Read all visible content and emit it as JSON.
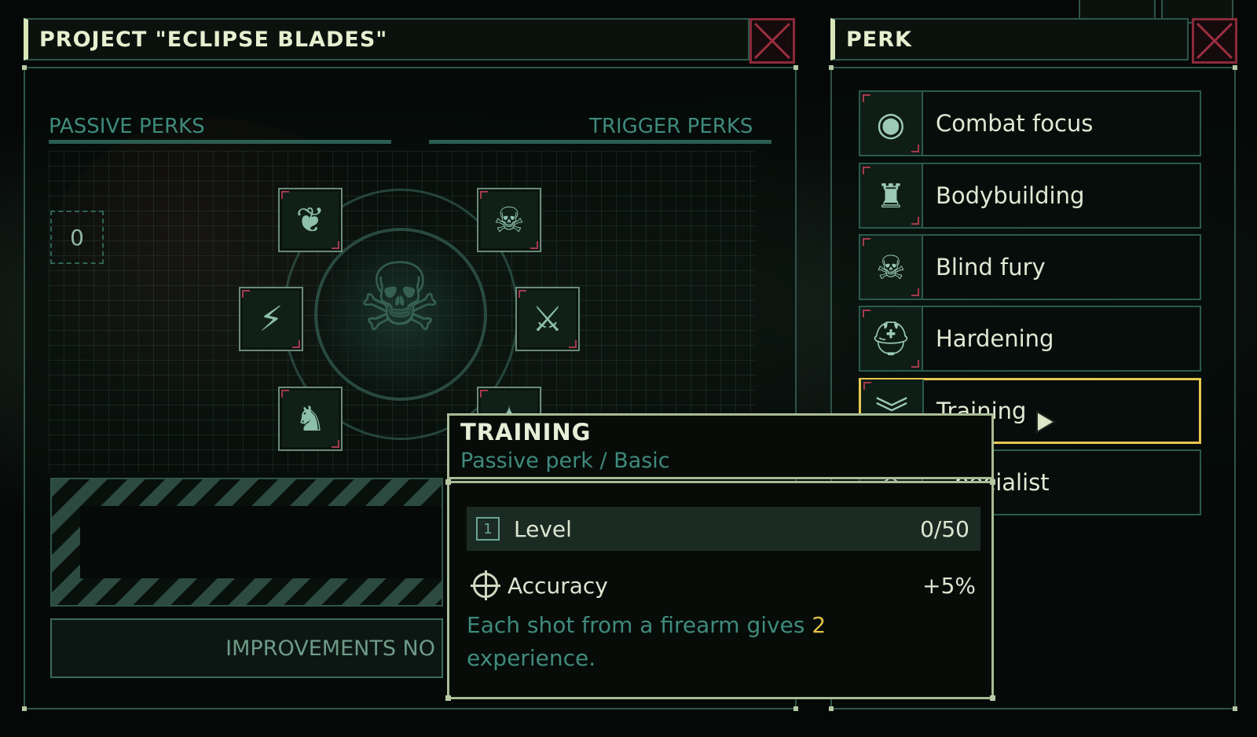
{
  "project_panel": {
    "title": "PROJECT \"ECLIPSE BLADES\"",
    "passive_header": "PASSIVE PERKS",
    "trigger_header": "TRIGGER PERKS",
    "points_counter": "0",
    "improvements_button": "IMPROVEMENTS NO"
  },
  "perk_panel": {
    "title": "PERK",
    "items": [
      {
        "label": "Combat focus",
        "icon": "eye-icon"
      },
      {
        "label": "Bodybuilding",
        "icon": "muscle-icon"
      },
      {
        "label": "Blind fury",
        "icon": "skull-icon"
      },
      {
        "label": "Hardening",
        "icon": "helmet-icon"
      },
      {
        "label": "Training",
        "icon": "chevron-rank-icon",
        "selected": true
      },
      {
        "label": "pecialist",
        "icon": "specialist-icon"
      }
    ]
  },
  "tooltip": {
    "title": "TRAINING",
    "subtitle": "Passive perk / Basic",
    "level_label": "Level",
    "level_icon_text": "1",
    "level_value": "0/50",
    "stat_label": "Accuracy",
    "stat_value": "+5%",
    "desc_part1": "Each shot from a firearm gives ",
    "desc_highlight": "2",
    "desc_part2": "experience."
  },
  "colors": {
    "accent_gold": "#e6c84e",
    "teal_text": "#3f8a7c",
    "close_red": "#8b2a3a"
  }
}
